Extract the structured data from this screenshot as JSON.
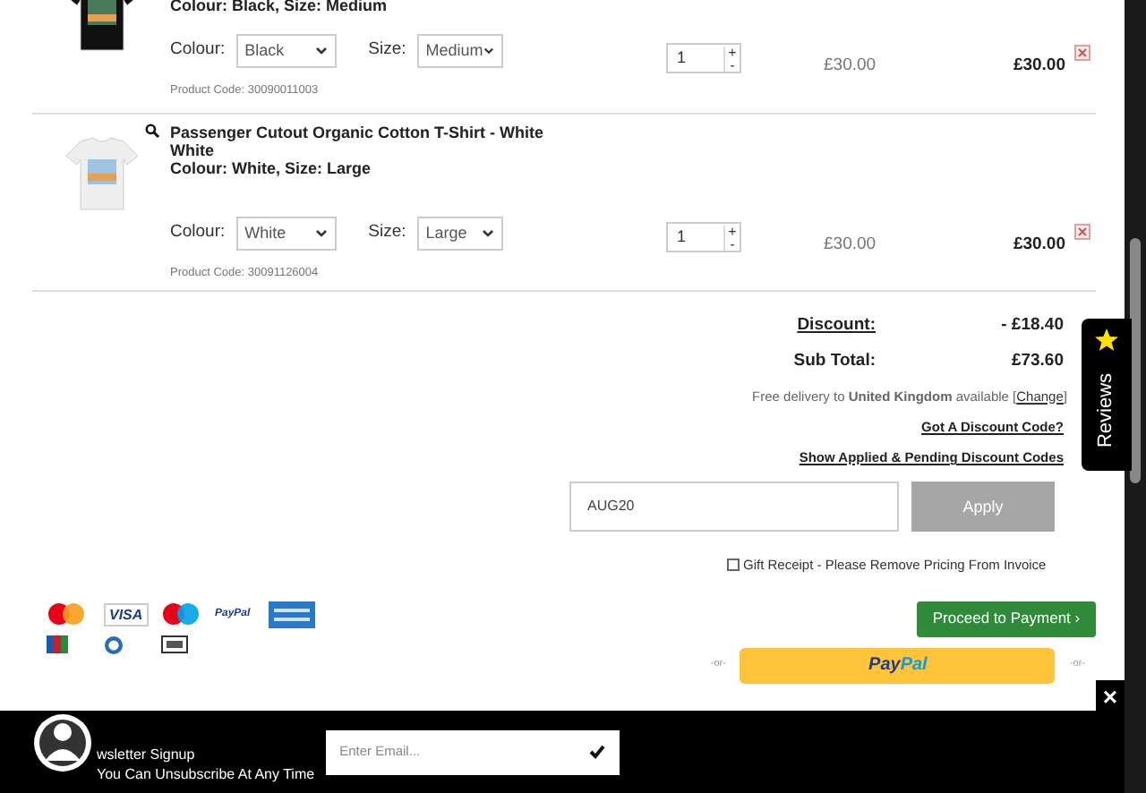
{
  "cart_items": [
    {
      "variant": "Colour: Black, Size: Medium",
      "colour_label": "Colour:",
      "colour": "Black",
      "size_label": "Size:",
      "size": "Medium",
      "quantity": "1",
      "plus": "+",
      "minus": "-",
      "price": "£30.00",
      "total": "£30.00",
      "code": "Product Code: 30090011003",
      "kind": "dark",
      "zoom": false
    },
    {
      "title": "Passenger Cutout Organic Cotton T-Shirt - White White",
      "variant": "Colour: White, Size: Large",
      "colour_label": "Colour:",
      "colour": "White",
      "size_label": "Size:",
      "size": "Large",
      "quantity": "1",
      "plus": "+",
      "minus": "-",
      "price": "£30.00",
      "total": "£30.00",
      "code": "Product Code: 30091126004",
      "kind": "light",
      "zoom": true
    }
  ],
  "totals": [
    {
      "label": "Discount:",
      "value": "- £18.40",
      "underlined": true
    },
    {
      "label": "Sub Total:",
      "value": "£73.60",
      "underlined": false
    }
  ],
  "delivery": {
    "text": "Free delivery to",
    "country": "United Kingdom",
    "suffix": "available [",
    "link": "Change",
    "end": "]"
  },
  "links": [
    "Got A Discount Code?",
    "Show Applied & Pending Discount Codes"
  ],
  "discount_input": {
    "value": "AUG20",
    "button": "Apply"
  },
  "gift_receipt": {
    "label": "Gift Receipt - Please Remove Pricing From Invoice",
    "checked": false
  },
  "payment_icons": [
    {
      "kind": "mastercard"
    },
    {
      "kind": "visa",
      "label": "VISA"
    },
    {
      "kind": "maestro"
    },
    {
      "kind": "paypal",
      "label": "PayPal"
    },
    {
      "kind": "amex"
    },
    {
      "kind": "jcb"
    },
    {
      "kind": "diners"
    },
    {
      "kind": "applepay"
    }
  ],
  "proceed_button": "Proceed to Payment ›",
  "paypal_row": {
    "or_left": "-or-",
    "parts": [
      "Pay",
      "Pal"
    ],
    "or_right": "-or-"
  },
  "reviews_tab": "Reviews",
  "newsletter": {
    "title": "wsletter Signup",
    "subtitle": "You Can Unsubscribe At Any Time",
    "placeholder": "Enter Email..."
  },
  "close": "×"
}
